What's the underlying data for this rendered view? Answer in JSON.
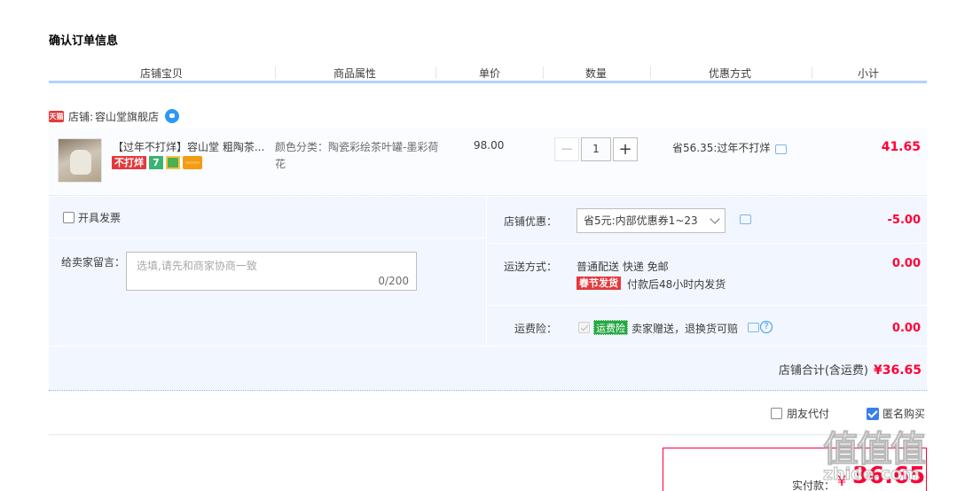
{
  "page": {
    "title": "确认订单信息"
  },
  "columns": [
    "店铺宝贝",
    "商品属性",
    "单价",
    "数量",
    "优惠方式",
    "小计"
  ],
  "shop": {
    "badge": "天猫",
    "label": "店铺:",
    "name": "容山堂旗舰店"
  },
  "item": {
    "title": "【过年不打烊】容山堂 粗陶茶...",
    "badges": {
      "no_close": "不打烊",
      "seven": "7"
    },
    "attribute": "颜色分类：陶瓷彩绘茶叶罐-墨彩荷花",
    "price": "98.00",
    "quantity": "1",
    "minus": "−",
    "plus": "+",
    "discount": "省56.35:过年不打烊",
    "subtotal": "41.65"
  },
  "invoice": {
    "label": "开具发票"
  },
  "message": {
    "label": "给卖家留言：",
    "placeholder": "选填,请先和商家协商一致",
    "count": "0/200"
  },
  "coupon": {
    "label": "店铺优惠：",
    "selected": "省5元:内部优惠券1~23",
    "value": "-5.00"
  },
  "shipping": {
    "label": "运送方式：",
    "method": "普通配送 快递 免邮",
    "badge": "春节发货",
    "note": "付款后48小时内发货",
    "value": "0.00"
  },
  "insurance": {
    "label": "运费险：",
    "badge": "运费险",
    "text": "卖家赠送，退换货可赔",
    "help": "?",
    "value": "0.00"
  },
  "shop_total": {
    "label": "店铺合计(含运费)",
    "value": "¥36.65"
  },
  "options": {
    "friend_pay": "朋友代付",
    "anonymous": "匿名购买"
  },
  "payment": {
    "label": "实付款：",
    "currency": "¥",
    "amount": "36.65"
  },
  "watermark": {
    "main": "值值值",
    "sub": "zhide.com"
  },
  "colors": {
    "accent_red": "#ff0036",
    "header_line": "#b2d1ff",
    "panel_bg": "#f2f7ff",
    "check_blue": "#3b7fe8"
  }
}
